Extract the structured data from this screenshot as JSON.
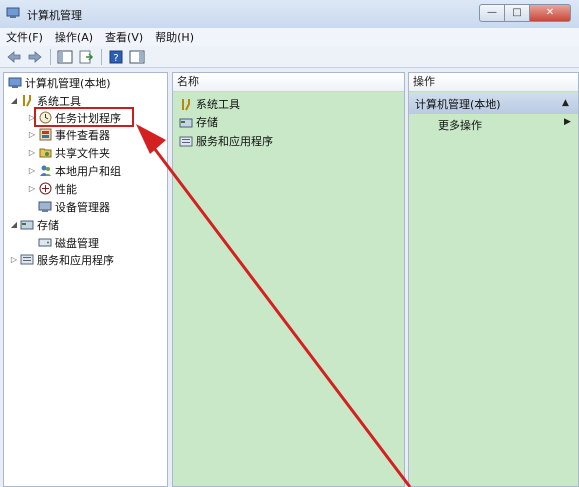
{
  "window": {
    "title": "计算机管理"
  },
  "menu": [
    {
      "label": "文件(F)"
    },
    {
      "label": "操作(A)"
    },
    {
      "label": "查看(V)"
    },
    {
      "label": "帮助(H)"
    }
  ],
  "tree": {
    "root": "计算机管理(本地)",
    "system_tools": "系统工具",
    "task_scheduler": "任务计划程序",
    "event_viewer": "事件查看器",
    "shared_folders": "共享文件夹",
    "local_users": "本地用户和组",
    "performance": "性能",
    "device_manager": "设备管理器",
    "storage": "存储",
    "disk_management": "磁盘管理",
    "services_apps": "服务和应用程序"
  },
  "middle": {
    "header": "名称",
    "items": [
      {
        "label": "系统工具"
      },
      {
        "label": "存储"
      },
      {
        "label": "服务和应用程序"
      }
    ]
  },
  "actions": {
    "header": "操作",
    "section": "计算机管理(本地)",
    "more": "更多操作"
  },
  "accent": {
    "annotation": "#d42020",
    "pane_bg": "#c8e8c8"
  }
}
